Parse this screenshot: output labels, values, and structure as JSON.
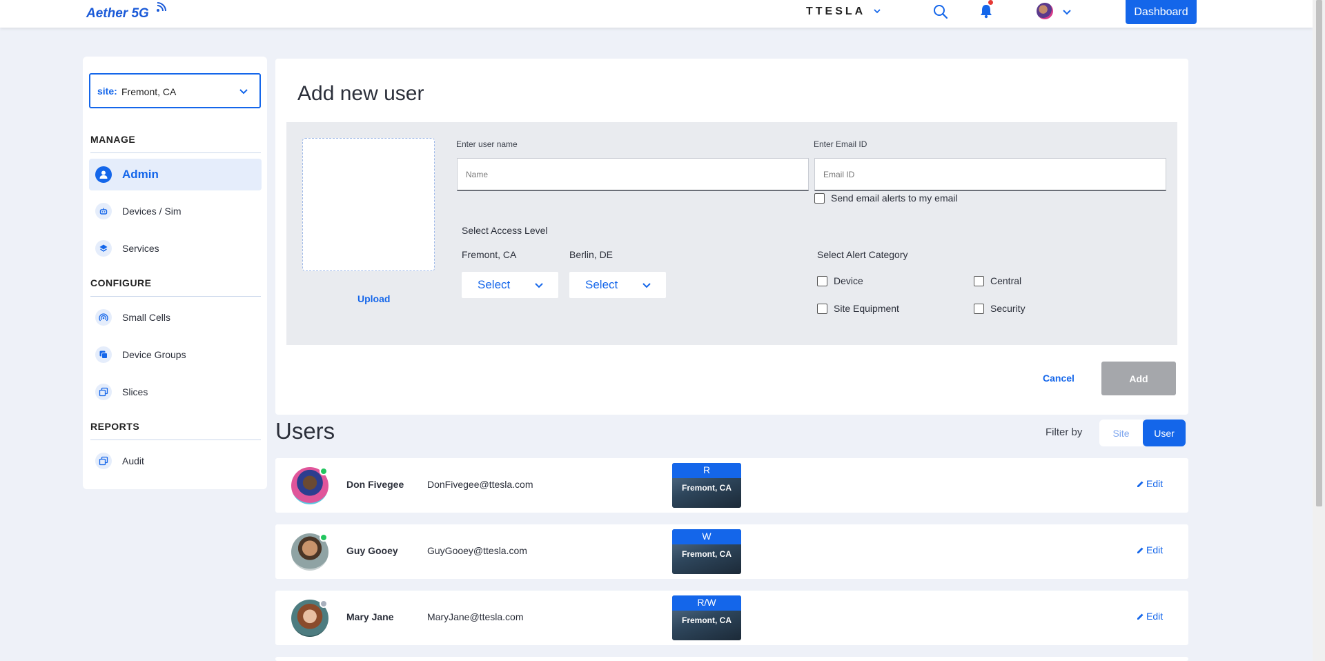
{
  "topbar": {
    "app_name": "Aether 5G",
    "brand": "TTESLA",
    "dashboard_label": "Dashboard"
  },
  "sidebar": {
    "site_label": "site:",
    "site_value": "Fremont, CA",
    "sections": {
      "manage": "MANAGE",
      "configure": "CONFIGURE",
      "reports": "REPORTS"
    },
    "items": [
      {
        "label": "Admin",
        "icon": "user-icon",
        "active": true
      },
      {
        "label": "Devices / Sim",
        "icon": "robot-icon"
      },
      {
        "label": "Services",
        "icon": "layers-icon"
      },
      {
        "label": "Small Cells",
        "icon": "signal-icon"
      },
      {
        "label": "Device Groups",
        "icon": "device-groups-icon"
      },
      {
        "label": "Slices",
        "icon": "slices-icon"
      },
      {
        "label": "Audit",
        "icon": "audit-icon"
      }
    ]
  },
  "form": {
    "title": "Add new user",
    "upload_label": "Upload",
    "username_label": "Enter user name",
    "username_placeholder": "Name",
    "email_label": "Enter Email ID",
    "email_placeholder": "Email ID",
    "email_alerts_label": "Send email alerts to my email",
    "access_level_label": "Select Access Level",
    "sites": [
      {
        "name": "Fremont, CA",
        "select": "Select"
      },
      {
        "name": "Berlin, DE",
        "select": "Select"
      }
    ],
    "alert_category_label": "Select Alert Category",
    "alert_categories": [
      "Device",
      "Central",
      "Site Equipment",
      "Security"
    ],
    "cancel_label": "Cancel",
    "add_label": "Add"
  },
  "users": {
    "title": "Users",
    "filter_by": "Filter by",
    "filter_site": "Site",
    "filter_user": "User",
    "edit_label": "Edit",
    "rows": [
      {
        "name": "Don Fivegee",
        "email": "DonFivegee@ttesla.com",
        "access": "R",
        "site": "Fremont, CA",
        "status_color": "#22c55e"
      },
      {
        "name": "Guy Gooey",
        "email": "GuyGooey@ttesla.com",
        "access": "W",
        "site": "Fremont, CA",
        "status_color": "#22c55e"
      },
      {
        "name": "Mary Jane",
        "email": "MaryJane@ttesla.com",
        "access": "R/W",
        "site": "Fremont, CA",
        "status_color": "#a8b0bd"
      }
    ]
  },
  "colors": {
    "accent": "#1466ea",
    "background": "#eef1f8",
    "disabled_button": "#a5a7ab"
  }
}
